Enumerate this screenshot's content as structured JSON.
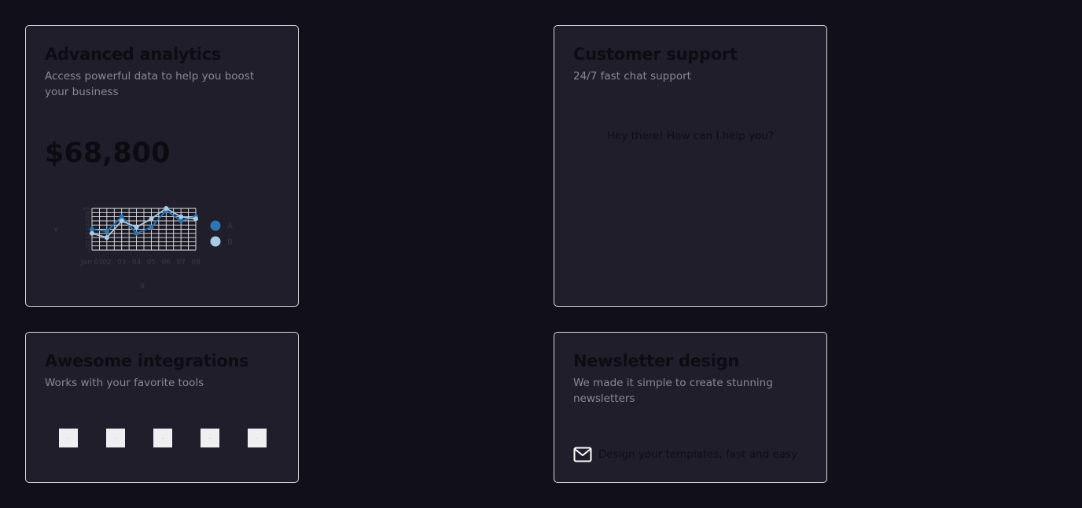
{
  "analytics": {
    "title": "Advanced analytics",
    "description": "Access powerful data to help you boost your business",
    "value": "$68,800"
  },
  "chart_data": {
    "type": "line",
    "x": [
      "Jan 01",
      "Jan 02",
      "Jan 03",
      "Jan 04",
      "Jan 05",
      "Jan 06",
      "Jan 07",
      "Jan 08"
    ],
    "x_tick_labels": [
      "Jan 01",
      "02",
      "03",
      "04",
      "05",
      "06",
      "07",
      "08"
    ],
    "series": [
      {
        "name": "A",
        "values": [
          50,
          45,
          80,
          40,
          55,
          95,
          70,
          80
        ],
        "color": "#2c76b8"
      },
      {
        "name": "B",
        "values": [
          40,
          30,
          70,
          55,
          75,
          100,
          80,
          75
        ],
        "color": "#a9cce6"
      }
    ],
    "xlabel": "X",
    "ylabel": "Y",
    "ylim": [
      0,
      100
    ],
    "y_ticks": [
      0,
      10,
      20,
      30,
      40,
      50,
      60,
      70,
      80,
      90,
      100
    ],
    "grid": true,
    "legend": "right"
  },
  "support": {
    "title": "Customer support",
    "description": "24/7 fast chat support",
    "message": "Hey there! How can I help you?"
  },
  "integrations": {
    "title": "Awesome integrations",
    "description": "Works with your favorite tools",
    "tools": [
      "tool-1",
      "tool-2",
      "tool-3",
      "tool-4",
      "tool-5"
    ]
  },
  "newsletter": {
    "title": "Newsletter design",
    "description": "We made it simple to create stunning newsletters",
    "feature_text": "Design your templates, fast and easy",
    "icon": "mail-icon"
  }
}
